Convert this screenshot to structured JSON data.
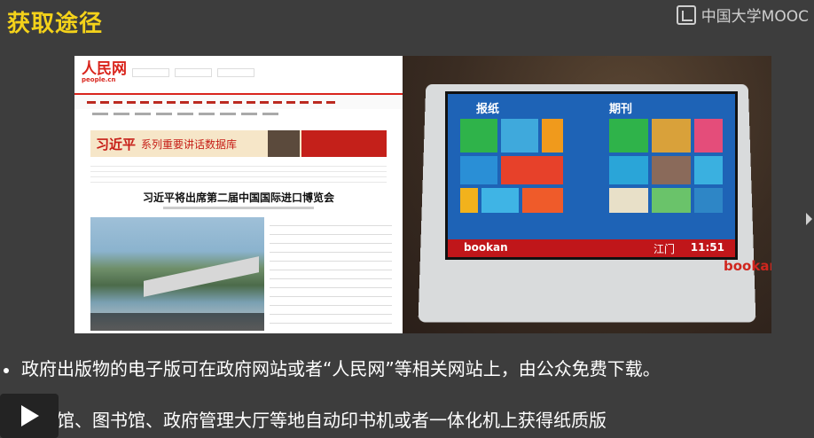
{
  "slide": {
    "title": "获取途径",
    "logo_text": "中国大学MOOC",
    "bullets": [
      "政府出版物的电子版可在政府网站或者“人民网”等相关网站上，由公众免费下载。",
      "档案馆、图书馆、政府管理大厅等地自动印书机或者一体化机上获得纸质版"
    ]
  },
  "photo": {
    "website": {
      "brand": "人民网",
      "brand_sub": "people.cn",
      "banner_title": "习近平",
      "banner_subtitle": "系列重要讲话数据库",
      "headline": "习近平将出席第二届中国国际进口博览会"
    },
    "kiosk": {
      "section_left": "报纸",
      "section_right": "期刊",
      "brand": "bookan",
      "time": "11:51",
      "city": "江门"
    }
  },
  "icons": {
    "logo": "mooc-logo-icon",
    "play": "play-icon",
    "next": "chevron-right-icon"
  },
  "colors": {
    "title": "#f4d21a",
    "background": "#3d3d3d",
    "brand_red": "#d9251d",
    "kiosk_blue": "#1e63b6"
  }
}
